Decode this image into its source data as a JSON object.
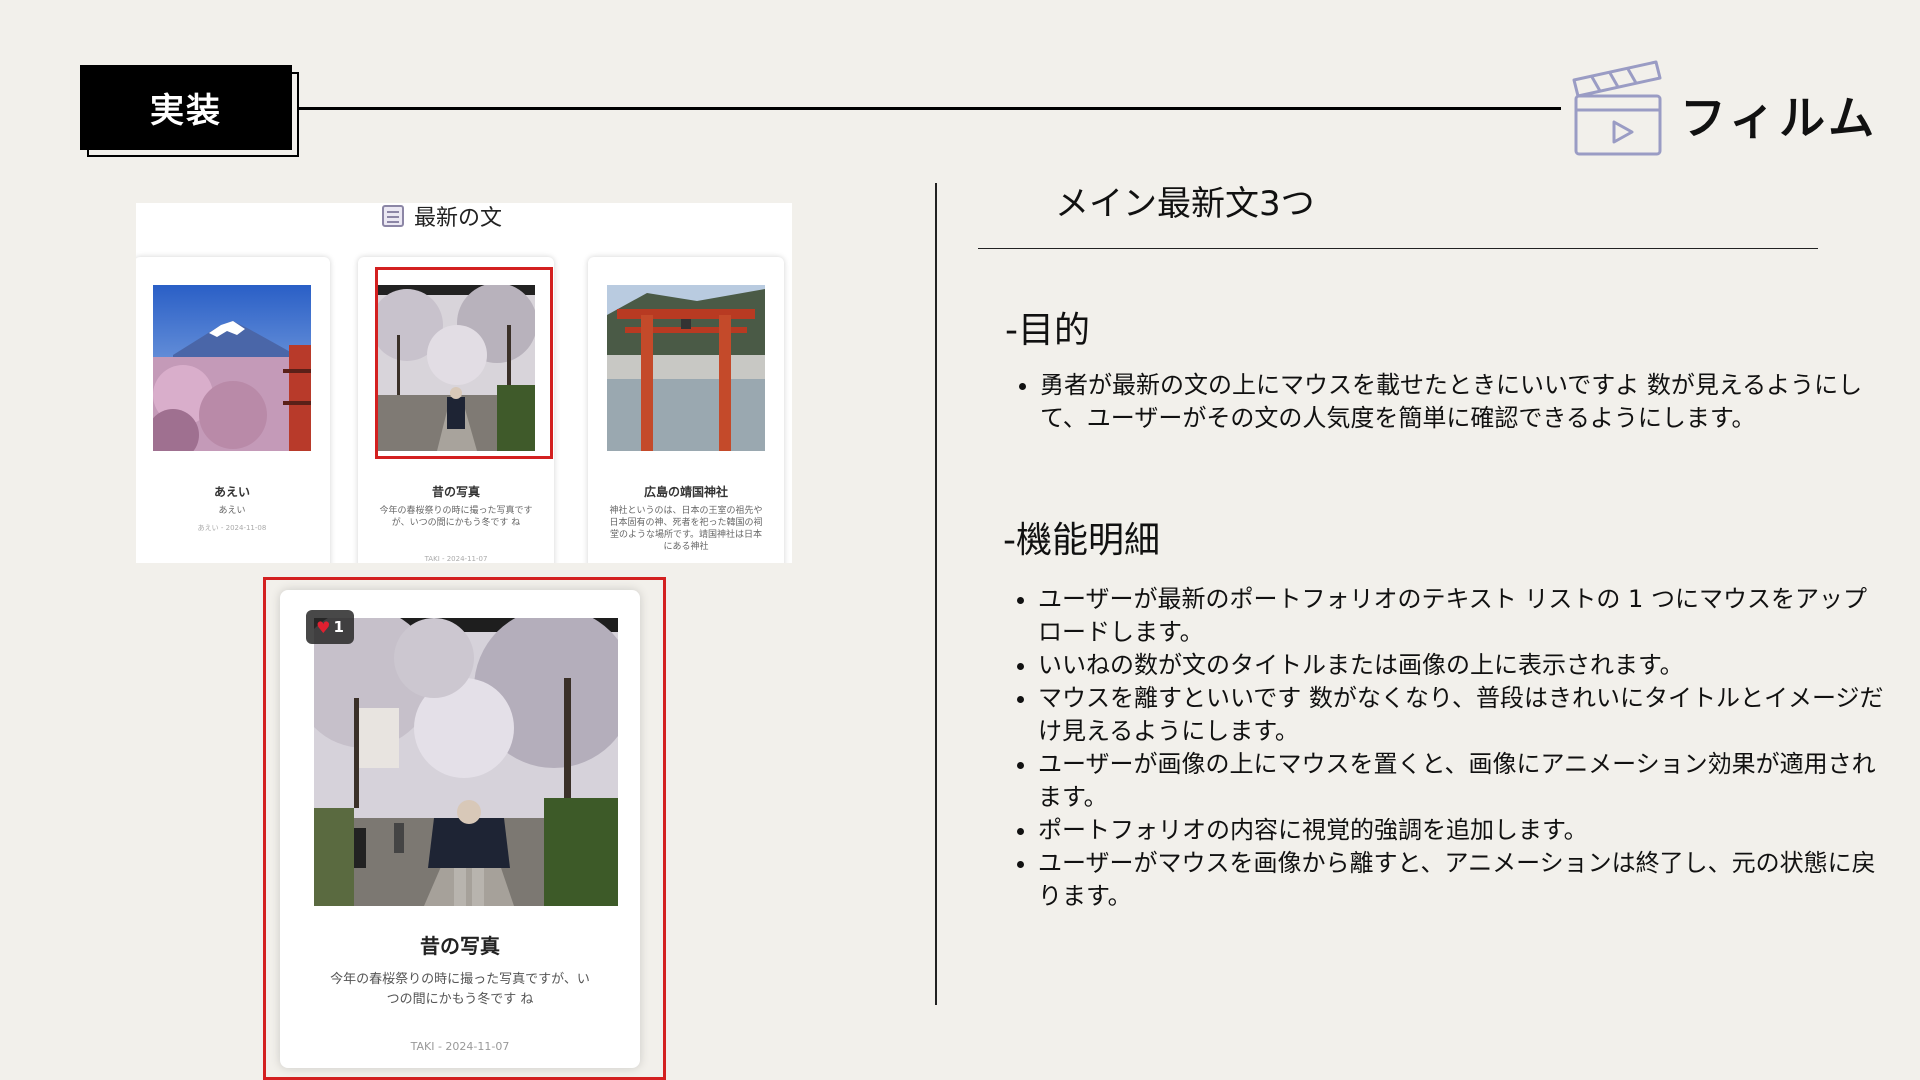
{
  "header": {
    "tag_label": "実装",
    "brand_name": "フィルム",
    "brand_icon": "clapperboard-icon"
  },
  "screenshot": {
    "section_title": "最新の文",
    "cards": [
      {
        "title": "あえい",
        "desc": "あえい",
        "meta": "あえい - 2024-11-08"
      },
      {
        "title": "昔の写真",
        "desc": "今年の春桜祭りの時に撮った写真ですが、いつの間にかもう冬です ね",
        "meta": "TAKI - 2024-11-07"
      },
      {
        "title": "広島の靖国神社",
        "desc": "神社というのは、日本の王室の祖先や日本固有の神、死者を祀った韓国の祠堂のような場所です。靖国神社は日本にある神社",
        "meta": ""
      }
    ],
    "featured": {
      "like_count": "1",
      "title": "昔の写真",
      "desc": "今年の春桜祭りの時に撮った写真ですが、いつの間にかもう冬です ね",
      "meta": "TAKI - 2024-11-07"
    }
  },
  "right": {
    "title": "メイン最新文3つ",
    "purpose_heading": "-目的",
    "purpose_items": [
      "勇者が最新の文の上にマウスを載せたときにいいですよ 数が見えるようにして、ユーザーがその文の人気度を簡単に確認できるようにします。"
    ],
    "spec_heading": "-機能明細",
    "spec_items": [
      "ユーザーが最新のポートフォリオのテキスト リストの 1 つにマウスをアップロードします。",
      "いいねの数が文のタイトルまたは画像の上に表示されます。",
      "マウスを離すといいです 数がなくなり、普段はきれいにタイトルとイメージだけ見えるようにします。",
      "ユーザーが画像の上にマウスを置くと、画像にアニメーション効果が適用されます。",
      "ポートフォリオの内容に視覚的強調を追加します。",
      "ユーザーがマウスを画像から離すと、アニメーションは終了し、元の状態に戻ります。"
    ]
  },
  "colors": {
    "background": "#f2f0eb",
    "highlight": "#d32020",
    "heart": "#e02030",
    "icon": "#9a9cc4"
  }
}
